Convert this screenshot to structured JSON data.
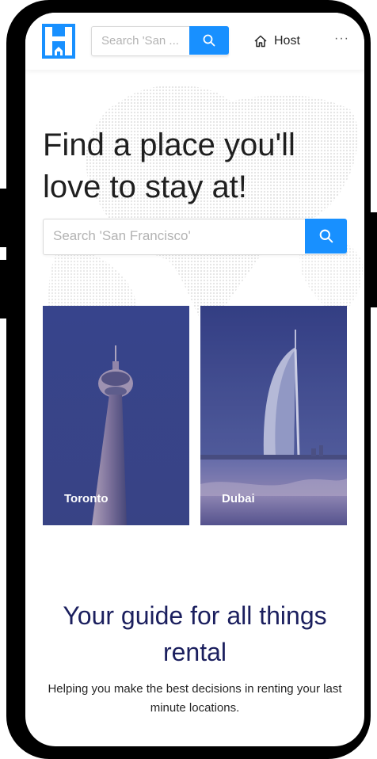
{
  "header": {
    "search_placeholder": "Search 'San ...",
    "host_label": "Host",
    "more_label": "···"
  },
  "hero": {
    "title": "Find a place you'll love to stay at!",
    "search_placeholder": "Search 'San Francisco'"
  },
  "cities": [
    {
      "name": "Toronto"
    },
    {
      "name": "Dubai"
    }
  ],
  "guide": {
    "title": "Your guide for all things rental",
    "description": "Helping you make the best decisions in renting your last minute locations."
  },
  "colors": {
    "primary": "#1890ff",
    "heading_navy": "#1b1f5e",
    "card_overlay": "#2f3a7a"
  },
  "icons": [
    "logo-icon",
    "search-icon",
    "home-icon",
    "more-icon"
  ]
}
